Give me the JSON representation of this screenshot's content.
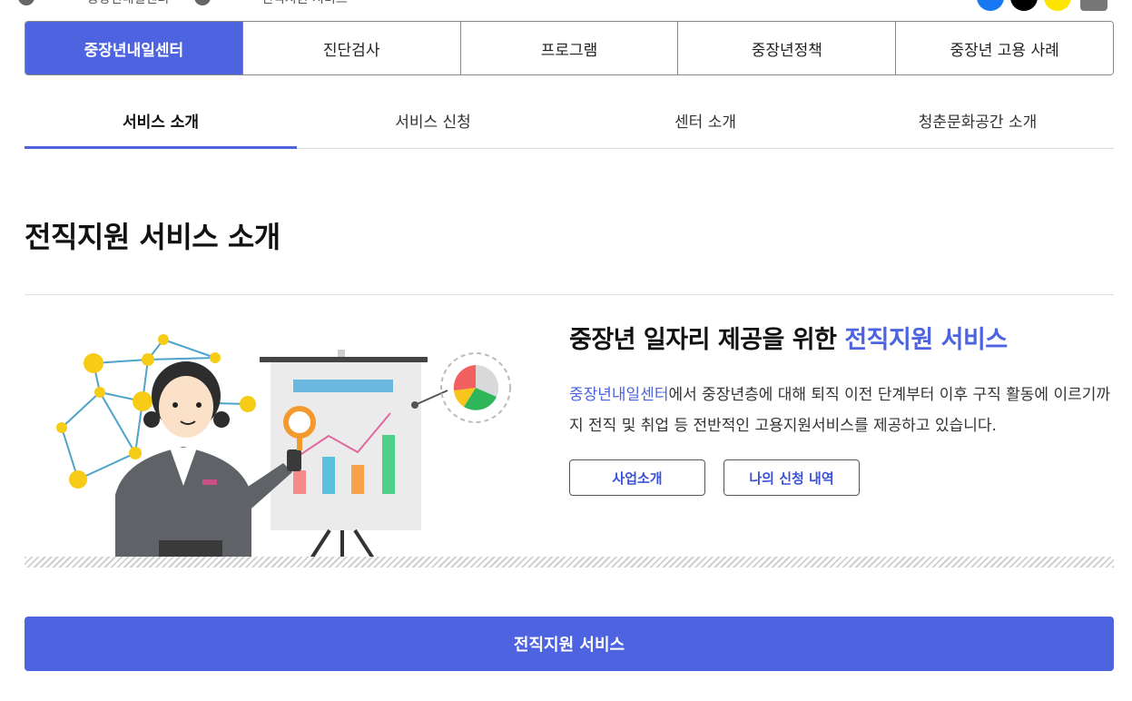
{
  "breadcrumb": {
    "items": [
      "중장년내일센터",
      "전직지원 서비스"
    ]
  },
  "main_tabs": [
    {
      "label": "중장년내일센터",
      "active": true
    },
    {
      "label": "진단검사",
      "active": false
    },
    {
      "label": "프로그램",
      "active": false
    },
    {
      "label": "중장년정책",
      "active": false
    },
    {
      "label": "중장년 고용 사례",
      "active": false
    }
  ],
  "sub_tabs": [
    {
      "label": "서비스 소개",
      "active": true
    },
    {
      "label": "서비스 신청",
      "active": false
    },
    {
      "label": "센터 소개",
      "active": false
    },
    {
      "label": "청춘문화공간 소개",
      "active": false
    }
  ],
  "page_title": "전직지원 서비스 소개",
  "intro": {
    "heading_plain": "중장년 일자리 제공을 위한 ",
    "heading_accent": "전직지원 서비스",
    "body_accent": "중장년내일센터",
    "body_text": "에서 중장년층에 대해 퇴직 이전 단계부터 이후 구직 활동에 이르기까지 전직 및 취업 등 전반적인 고용지원서비스를 제공하고 있습니다.",
    "button_about": "사업소개",
    "button_my_applications": "나의 신청 내역"
  },
  "cta_button": "전직지원 서비스",
  "colors": {
    "accent": "#4d63e0",
    "facebook": "#1877f2",
    "x": "#000000",
    "kakao": "#fee500"
  },
  "share_icons": [
    "facebook-icon",
    "x-icon",
    "kakaotalk-icon",
    "print-icon"
  ]
}
